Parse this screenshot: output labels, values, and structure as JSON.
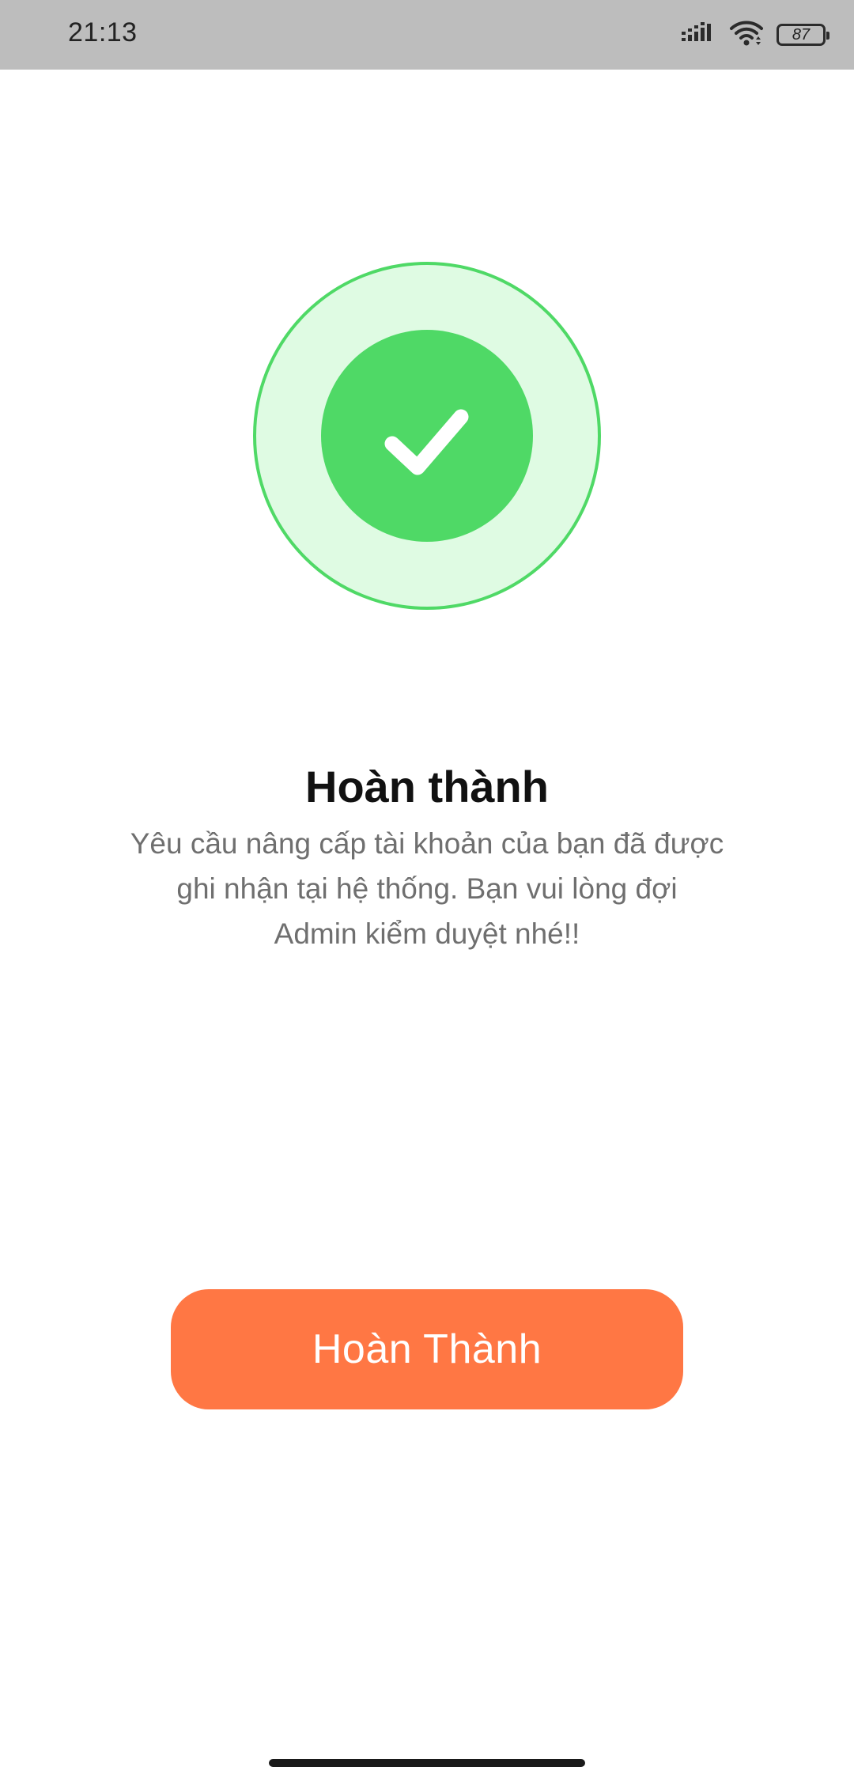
{
  "status_bar": {
    "time": "21:13",
    "battery_level": "87",
    "icons": [
      "signal-icon",
      "wifi-icon",
      "battery-icon"
    ]
  },
  "success": {
    "icon": "checkmark-icon",
    "colors": {
      "outer_fill": "#dffbe3",
      "outer_stroke": "#4fd966",
      "inner_fill": "#4fd966",
      "check": "#ffffff"
    }
  },
  "title": "Hoàn thành",
  "message_lines": [
    "Yêu cầu nâng cấp tài khoản của bạn đã được",
    "ghi nhận tại hệ thống. Bạn vui lòng đợi",
    "Admin kiểm duyệt nhé!!"
  ],
  "button": {
    "label": "Hoàn Thành",
    "color": "#ff7744"
  }
}
